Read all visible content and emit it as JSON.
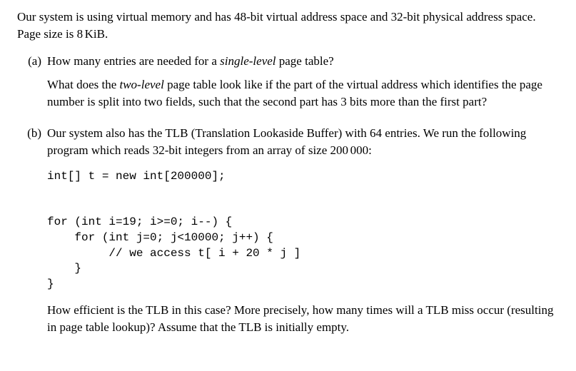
{
  "intro": {
    "sentence1": "Our system is using virtual memory and has 48-bit virtual address space and 32-bit physical address space.",
    "sentence2_prefix": "Page size is 8",
    "sentence2_suffix": "KiB."
  },
  "part_a": {
    "label": "(a)",
    "q1_before": "How many entries are needed for a ",
    "q1_em": "single-level",
    "q1_after": " page table?",
    "q2_before": "What does the ",
    "q2_em": "two-level",
    "q2_after": " page table look like if the part of the virtual address which identifies the page number is split into two fields, such that the second part has 3 bits more than the first part?"
  },
  "part_b": {
    "label": "(b)",
    "p1_before": "Our system also has the TLB (Translation Lookaside Buffer) with 64 entries. We run the following program which reads 32-bit integers from an array of size 200",
    "p1_after": "000:",
    "code": "int[] t = new int[200000];\n\n\nfor (int i=19; i>=0; i--) {\n    for (int j=0; j<10000; j++) {\n         // we access t[ i + 20 * j ]\n    }\n}",
    "p2": "How efficient is the TLB in this case? More precisely, how many times will a TLB miss occur (resulting in page table lookup)? Assume that the TLB is initially empty."
  }
}
